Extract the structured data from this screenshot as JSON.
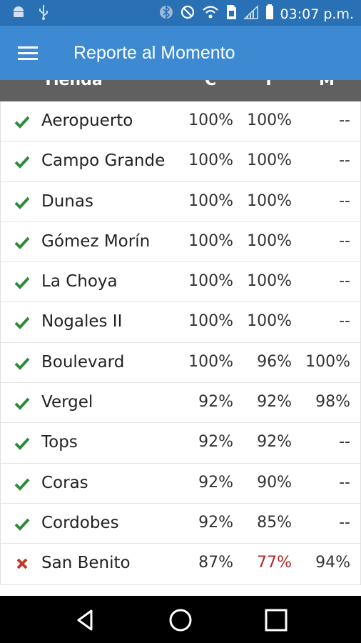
{
  "status": {
    "time": "03:07 p.m."
  },
  "app": {
    "title": "Reporte al Momento"
  },
  "header": {
    "tienda": "Tienda",
    "c": "C",
    "t": "T",
    "m": "M"
  },
  "rows": [
    {
      "status": "ok",
      "name": "Aeropuerto",
      "c": "100%",
      "t": "100%",
      "m": "--"
    },
    {
      "status": "ok",
      "name": "Campo Grande",
      "c": "100%",
      "t": "100%",
      "m": "--"
    },
    {
      "status": "ok",
      "name": "Dunas",
      "c": "100%",
      "t": "100%",
      "m": "--"
    },
    {
      "status": "ok",
      "name": "Gómez Morín",
      "c": "100%",
      "t": "100%",
      "m": "--"
    },
    {
      "status": "ok",
      "name": "La Choya",
      "c": "100%",
      "t": "100%",
      "m": "--"
    },
    {
      "status": "ok",
      "name": "Nogales II",
      "c": "100%",
      "t": "100%",
      "m": "--"
    },
    {
      "status": "ok",
      "name": "Boulevard",
      "c": "100%",
      "t": "96%",
      "m": "100%"
    },
    {
      "status": "ok",
      "name": "Vergel",
      "c": "92%",
      "t": "92%",
      "m": "98%"
    },
    {
      "status": "ok",
      "name": "Tops",
      "c": "92%",
      "t": "92%",
      "m": "--"
    },
    {
      "status": "ok",
      "name": "Coras",
      "c": "92%",
      "t": "90%",
      "m": "--"
    },
    {
      "status": "ok",
      "name": "Cordobes",
      "c": "92%",
      "t": "85%",
      "m": "--"
    },
    {
      "status": "bad",
      "name": "San Benito",
      "c": "87%",
      "t": "77%",
      "m": "94%",
      "t_highlight": true
    }
  ],
  "colors": {
    "ok": "#2e8b3a",
    "bad": "#c0392b",
    "alert_text": "#b12a2a",
    "app_bar": "#3d8ad3",
    "status_bar": "#2a70b5"
  }
}
